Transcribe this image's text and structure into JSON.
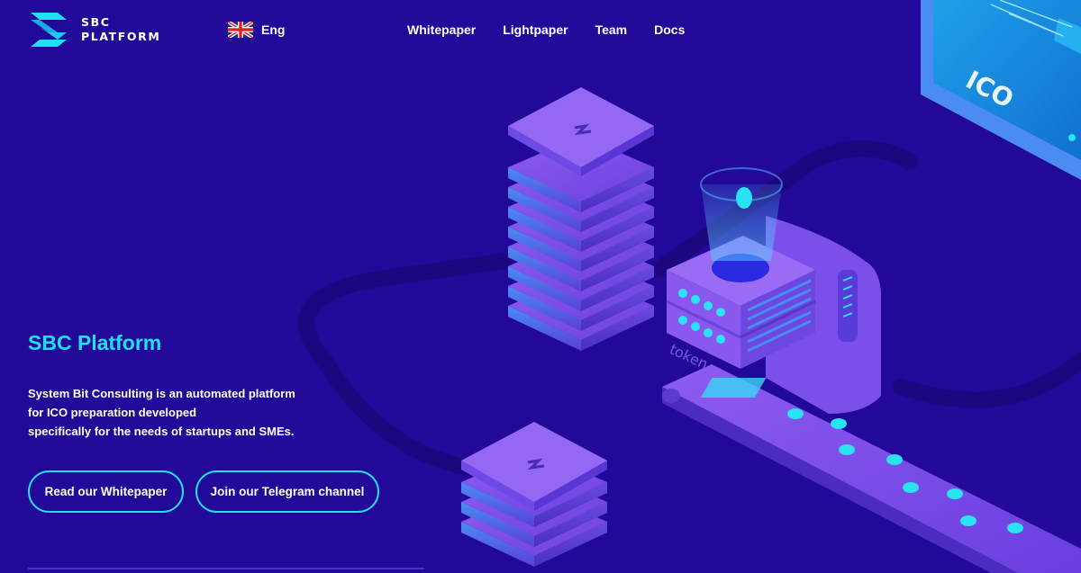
{
  "brand": {
    "line1": "SBC",
    "line2": "PLATFORM",
    "colors": {
      "background": "#22099a",
      "accent": "#21e0f4",
      "text": "#ffffff"
    }
  },
  "language": {
    "label": "Eng",
    "flag_icon": "uk-flag-icon"
  },
  "nav": {
    "whitepaper": "Whitepaper",
    "lightpaper": "Lightpaper",
    "team": "Team",
    "docs": "Docs"
  },
  "hero": {
    "title": "SBC Platform",
    "description_lines": [
      "System Bit Consulting is an automated platform",
      "for ICO preparation developed",
      "specifically for the needs of startups and SMEs."
    ],
    "button_whitepaper": "Read our Whitepaper",
    "button_telegram": "Join our Telegram channel"
  },
  "illustration": {
    "screen_label": "ICO",
    "machine_label": "token",
    "icons": [
      "server-stack-icon",
      "conveyor-belt-icon",
      "coin-icon",
      "monitor-icon"
    ]
  }
}
